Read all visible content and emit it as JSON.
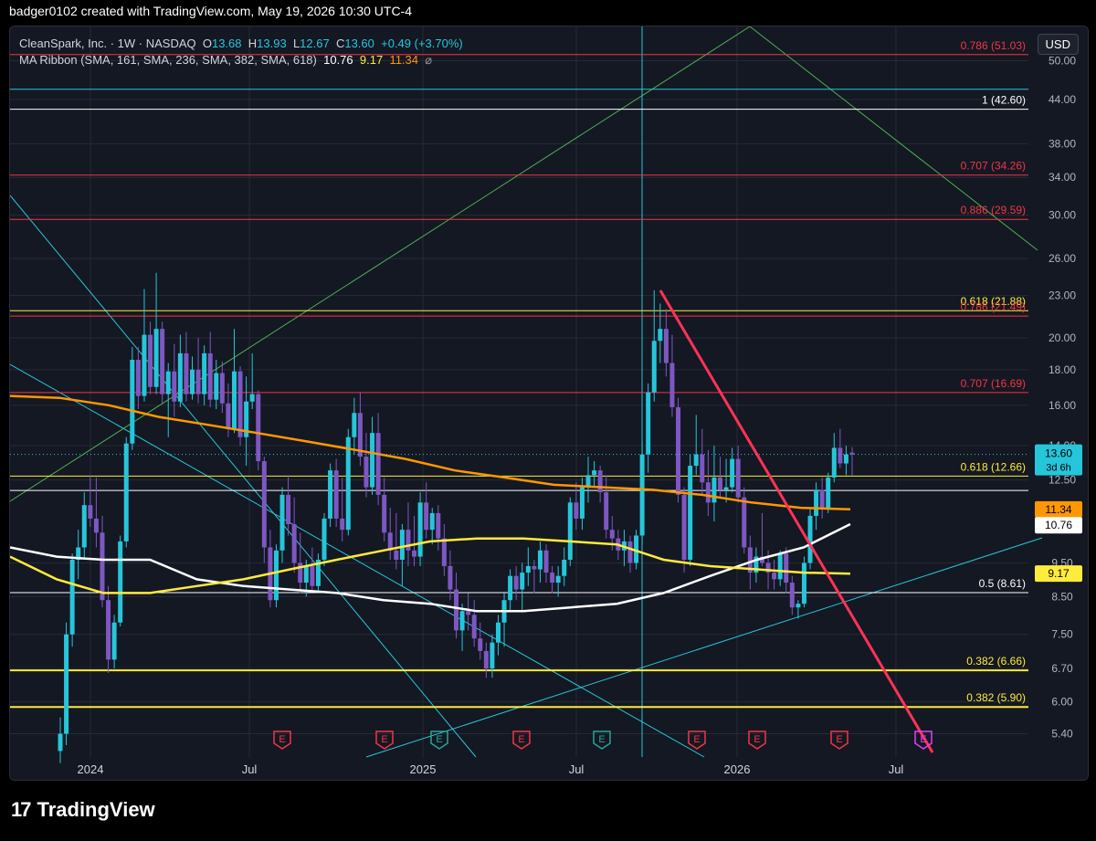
{
  "header": {
    "text": "badger0102 created with TradingView.com, May 19, 2026 10:30 UTC-4"
  },
  "legend": {
    "line1_name": "CleanSpark, Inc. · 1W · NASDAQ",
    "o_label": "O",
    "o_value": "13.68",
    "h_label": "H",
    "h_value": "13.93",
    "l_label": "L",
    "l_value": "12.67",
    "c_label": "C",
    "c_value": "13.60",
    "change": "+0.49 (+3.70%)",
    "line2_name": "MA Ribbon (SMA, 161, SMA, 236, SMA, 382, SMA, 618)",
    "ma1": "10.76",
    "ma2": "9.17",
    "ma3": "11.34",
    "eye": "⌀"
  },
  "currency_button": "USD",
  "footer": {
    "logo_mark": "17",
    "brand": "TradingView"
  },
  "colors": {
    "bg": "#141823",
    "grid": "#262a36",
    "candle": "#7e57c2",
    "candle_up": "#26c6da",
    "red_level": "#f23645",
    "yellow_level": "#ffeb3b",
    "white_level": "#ffffff",
    "cyan": "#26c6da",
    "green": "#4caf50",
    "orange": "#ff9800",
    "trend": "#ff3355"
  },
  "chart_data": {
    "type": "candlestick",
    "symbol": "CleanSpark, Inc.",
    "interval": "1W",
    "exchange": "NASDAQ",
    "y_scale": "log",
    "ylim": [
      5.0,
      56.0
    ],
    "y_ticks": [
      "50.00",
      "44.00",
      "38.00",
      "34.00",
      "30.00",
      "26.00",
      "23.00",
      "20.00",
      "18.00",
      "16.00",
      "14.00",
      "12.50",
      "9.50",
      "8.50",
      "7.50",
      "6.70",
      "6.00",
      "5.40"
    ],
    "x_ticks": [
      "2024",
      "Jul",
      "2025",
      "Jul",
      "2026",
      "Jul"
    ],
    "last_price": {
      "value": "13.60",
      "countdown": "3d 6h"
    },
    "ma_labels": [
      {
        "value": "11.34",
        "color": "#ff9800"
      },
      {
        "value": "10.76",
        "color": "#ffffff"
      },
      {
        "value": "9.17",
        "color": "#ffeb3b"
      }
    ],
    "levels": [
      {
        "label": "0.786 (51.03)",
        "price": 51.03,
        "color": "#f23645"
      },
      {
        "label": "",
        "price": 45.5,
        "color": "#26c6da"
      },
      {
        "label": "1 (42.60)",
        "price": 42.6,
        "color": "#ffffff"
      },
      {
        "label": "0.707 (34.26)",
        "price": 34.26,
        "color": "#f23645"
      },
      {
        "label": "0.886 (29.59)",
        "price": 29.59,
        "color": "#f23645"
      },
      {
        "label": "0.618 (21.88)",
        "price": 21.88,
        "color": "#ffeb3b"
      },
      {
        "label": "0.786 (21.49)",
        "price": 21.49,
        "color": "#f23645"
      },
      {
        "label": "0.707 (16.69)",
        "price": 16.69,
        "color": "#f23645"
      },
      {
        "label": "0.618 (12.66)",
        "price": 12.66,
        "color": "#ffeb3b"
      },
      {
        "label": "",
        "price": 12.07,
        "color": "#ffffff"
      },
      {
        "label": "0.5 (8.61)",
        "price": 8.61,
        "color": "#ffffff"
      },
      {
        "label": "0.382 (6.66)",
        "price": 6.66,
        "color": "#ffeb3b"
      },
      {
        "label": "0.382 (5.90)",
        "price": 5.9,
        "color": "#ffeb3b"
      }
    ],
    "candles": [
      [
        5.1,
        5.7,
        4.9,
        5.4
      ],
      [
        5.4,
        7.8,
        5.2,
        7.5
      ],
      [
        7.5,
        9.8,
        7.2,
        9.6
      ],
      [
        9.6,
        10.6,
        9.0,
        10.0
      ],
      [
        10.0,
        12.0,
        9.6,
        11.5
      ],
      [
        11.5,
        12.7,
        10.7,
        11.0
      ],
      [
        11.0,
        12.6,
        10.0,
        10.5
      ],
      [
        10.5,
        11.1,
        8.2,
        8.4
      ],
      [
        8.4,
        8.8,
        6.6,
        6.9
      ],
      [
        6.9,
        8.0,
        6.7,
        7.8
      ],
      [
        7.8,
        10.4,
        7.7,
        10.2
      ],
      [
        10.2,
        14.4,
        10.0,
        14.1
      ],
      [
        14.1,
        19.4,
        13.8,
        18.6
      ],
      [
        18.6,
        19.4,
        15.8,
        16.5
      ],
      [
        16.5,
        23.5,
        16.2,
        20.2
      ],
      [
        20.2,
        21.1,
        16.6,
        17.0
      ],
      [
        17.0,
        24.8,
        16.6,
        20.6
      ],
      [
        20.6,
        21.1,
        16.1,
        16.6
      ],
      [
        16.6,
        18.4,
        14.4,
        17.9
      ],
      [
        17.9,
        19.6,
        15.4,
        16.2
      ],
      [
        16.2,
        20.2,
        15.9,
        19.0
      ],
      [
        19.0,
        20.4,
        16.2,
        16.6
      ],
      [
        16.6,
        18.8,
        16.3,
        18.0
      ],
      [
        18.0,
        20.0,
        16.1,
        16.6
      ],
      [
        16.6,
        19.5,
        16.0,
        19.0
      ],
      [
        19.0,
        20.4,
        15.9,
        16.3
      ],
      [
        16.3,
        18.6,
        15.8,
        17.8
      ],
      [
        17.8,
        18.5,
        15.6,
        16.1
      ],
      [
        16.1,
        17.2,
        14.4,
        14.8
      ],
      [
        14.8,
        20.6,
        14.6,
        17.9
      ],
      [
        17.9,
        18.2,
        14.0,
        14.4
      ],
      [
        14.4,
        17.6,
        13.1,
        16.2
      ],
      [
        16.2,
        19.0,
        15.8,
        16.6
      ],
      [
        16.6,
        16.8,
        12.9,
        13.3
      ],
      [
        13.3,
        13.5,
        9.5,
        10.0
      ],
      [
        10.0,
        10.6,
        8.2,
        8.4
      ],
      [
        8.4,
        10.1,
        8.2,
        9.9
      ],
      [
        9.9,
        12.2,
        9.5,
        11.9
      ],
      [
        11.9,
        12.7,
        10.4,
        10.8
      ],
      [
        10.8,
        11.8,
        9.2,
        9.5
      ],
      [
        9.5,
        10.5,
        8.6,
        8.9
      ],
      [
        8.9,
        9.6,
        8.5,
        9.4
      ],
      [
        9.4,
        10.0,
        8.7,
        8.8
      ],
      [
        8.8,
        9.8,
        8.6,
        9.6
      ],
      [
        9.6,
        11.2,
        9.4,
        11.0
      ],
      [
        11.0,
        13.2,
        10.7,
        12.9
      ],
      [
        12.9,
        13.4,
        10.7,
        11.0
      ],
      [
        11.0,
        12.6,
        10.2,
        10.6
      ],
      [
        10.6,
        14.8,
        10.4,
        14.4
      ],
      [
        14.4,
        16.4,
        13.6,
        15.6
      ],
      [
        15.6,
        16.7,
        13.1,
        13.5
      ],
      [
        13.5,
        14.6,
        11.8,
        12.2
      ],
      [
        12.2,
        15.4,
        11.9,
        14.6
      ],
      [
        14.6,
        15.6,
        11.5,
        11.9
      ],
      [
        11.9,
        12.6,
        10.2,
        10.5
      ],
      [
        10.5,
        11.4,
        9.6,
        9.9
      ],
      [
        9.9,
        11.2,
        9.3,
        9.6
      ],
      [
        9.6,
        10.8,
        8.8,
        10.6
      ],
      [
        10.6,
        11.6,
        9.4,
        9.9
      ],
      [
        9.9,
        11.1,
        9.4,
        9.7
      ],
      [
        9.7,
        12.0,
        9.4,
        11.6
      ],
      [
        11.6,
        12.4,
        10.3,
        10.6
      ],
      [
        10.6,
        11.4,
        10.1,
        11.2
      ],
      [
        11.2,
        11.5,
        9.9,
        10.3
      ],
      [
        10.3,
        10.8,
        9.1,
        9.4
      ],
      [
        9.4,
        9.9,
        8.4,
        8.7
      ],
      [
        8.7,
        9.2,
        7.4,
        7.6
      ],
      [
        7.6,
        8.3,
        7.1,
        8.1
      ],
      [
        8.1,
        8.6,
        7.6,
        8.0
      ],
      [
        8.0,
        8.4,
        7.2,
        7.4
      ],
      [
        7.4,
        7.8,
        6.9,
        7.1
      ],
      [
        7.1,
        7.3,
        6.5,
        6.7
      ],
      [
        6.7,
        7.5,
        6.5,
        7.3
      ],
      [
        7.3,
        8.0,
        7.0,
        7.8
      ],
      [
        7.8,
        8.6,
        7.2,
        8.4
      ],
      [
        8.4,
        9.3,
        8.1,
        9.1
      ],
      [
        9.1,
        9.4,
        8.4,
        8.7
      ],
      [
        8.7,
        9.5,
        8.1,
        9.2
      ],
      [
        9.2,
        10.0,
        8.8,
        9.4
      ],
      [
        9.4,
        9.6,
        8.6,
        9.3
      ],
      [
        9.3,
        10.2,
        8.9,
        9.9
      ],
      [
        9.9,
        10.1,
        8.9,
        9.2
      ],
      [
        9.2,
        9.4,
        8.6,
        8.9
      ],
      [
        8.9,
        9.4,
        8.5,
        9.1
      ],
      [
        9.1,
        10.0,
        8.8,
        9.6
      ],
      [
        9.6,
        11.8,
        9.4,
        11.6
      ],
      [
        11.6,
        12.4,
        10.6,
        11.0
      ],
      [
        11.0,
        12.6,
        10.6,
        12.2
      ],
      [
        12.2,
        13.5,
        11.6,
        12.7
      ],
      [
        12.7,
        13.3,
        12.2,
        12.9
      ],
      [
        12.9,
        13.1,
        11.6,
        12.0
      ],
      [
        12.0,
        12.7,
        10.3,
        10.6
      ],
      [
        10.6,
        11.1,
        9.9,
        10.3
      ],
      [
        10.3,
        10.6,
        9.6,
        9.9
      ],
      [
        9.9,
        10.6,
        9.4,
        10.2
      ],
      [
        10.2,
        10.4,
        9.2,
        9.5
      ],
      [
        9.5,
        10.6,
        9.3,
        10.4
      ],
      [
        10.4,
        14.2,
        10.1,
        13.6
      ],
      [
        13.6,
        17.2,
        12.8,
        16.7
      ],
      [
        16.7,
        23.4,
        16.2,
        19.8
      ],
      [
        19.8,
        22.4,
        18.4,
        20.6
      ],
      [
        20.6,
        22.0,
        17.6,
        18.4
      ],
      [
        18.4,
        20.2,
        15.4,
        15.9
      ],
      [
        15.9,
        16.4,
        11.6,
        11.9
      ],
      [
        11.9,
        12.2,
        9.2,
        9.6
      ],
      [
        9.6,
        13.6,
        9.4,
        13.1
      ],
      [
        13.1,
        15.5,
        12.7,
        13.6
      ],
      [
        13.6,
        14.8,
        11.9,
        12.4
      ],
      [
        12.4,
        13.8,
        11.1,
        11.6
      ],
      [
        11.6,
        14.0,
        10.9,
        12.6
      ],
      [
        12.6,
        13.5,
        11.8,
        12.1
      ],
      [
        12.1,
        13.4,
        11.6,
        12.2
      ],
      [
        12.2,
        13.9,
        12.0,
        13.4
      ],
      [
        13.4,
        14.0,
        11.6,
        11.8
      ],
      [
        11.8,
        12.2,
        9.8,
        10.0
      ],
      [
        10.0,
        10.4,
        8.7,
        9.2
      ],
      [
        9.2,
        10.0,
        8.9,
        9.7
      ],
      [
        9.7,
        11.2,
        9.4,
        9.5
      ],
      [
        9.5,
        9.9,
        8.7,
        9.2
      ],
      [
        9.2,
        9.6,
        8.7,
        9.0
      ],
      [
        9.0,
        9.9,
        8.8,
        9.8
      ],
      [
        9.8,
        10.0,
        8.6,
        8.9
      ],
      [
        8.9,
        9.1,
        8.0,
        8.2
      ],
      [
        8.2,
        8.4,
        7.9,
        8.3
      ],
      [
        8.3,
        9.7,
        8.2,
        9.5
      ],
      [
        9.5,
        11.4,
        9.3,
        11.1
      ],
      [
        11.1,
        12.4,
        10.6,
        12.1
      ],
      [
        12.1,
        12.6,
        11.0,
        11.4
      ],
      [
        11.4,
        12.8,
        11.2,
        12.6
      ],
      [
        12.6,
        14.6,
        12.4,
        13.9
      ],
      [
        13.9,
        14.8,
        13.0,
        13.2
      ],
      [
        13.2,
        14.0,
        12.7,
        13.6
      ],
      [
        13.68,
        13.93,
        12.67,
        13.6
      ]
    ],
    "ma_series": [
      {
        "name": "SMA 161",
        "color": "#ffffff",
        "values": [
          10.0,
          9.7,
          9.6,
          9.6,
          9.0,
          8.8,
          8.7,
          8.6,
          8.4,
          8.3,
          8.1,
          8.1,
          8.2,
          8.3,
          8.6,
          9.1,
          9.6,
          10.0,
          10.8
        ]
      },
      {
        "name": "SMA 236",
        "color": "#ffeb3b",
        "values": [
          9.7,
          9.0,
          8.6,
          8.6,
          8.8,
          9.0,
          9.3,
          9.6,
          9.9,
          10.2,
          10.3,
          10.3,
          10.2,
          10.1,
          9.6,
          9.4,
          9.3,
          9.2,
          9.17
        ]
      },
      {
        "name": "SMA 382",
        "color": "#ff9800",
        "values": [
          16.5,
          16.4,
          16.0,
          15.4,
          15.0,
          14.6,
          14.2,
          13.8,
          13.4,
          12.9,
          12.6,
          12.3,
          12.2,
          12.1,
          11.9,
          11.6,
          11.4,
          11.34
        ]
      }
    ],
    "earnings_markers": [
      {
        "label": "E",
        "color": "#f23645"
      },
      {
        "label": "E",
        "color": "#f23645"
      },
      {
        "label": "E",
        "color": "#26a69a"
      },
      {
        "label": "E",
        "color": "#f23645"
      },
      {
        "label": "E",
        "color": "#26a69a"
      },
      {
        "label": "E",
        "color": "#f23645"
      },
      {
        "label": "E",
        "color": "#f23645"
      },
      {
        "label": "E",
        "color": "#f23645"
      },
      {
        "label": "E",
        "color": "#e040fb"
      }
    ]
  }
}
